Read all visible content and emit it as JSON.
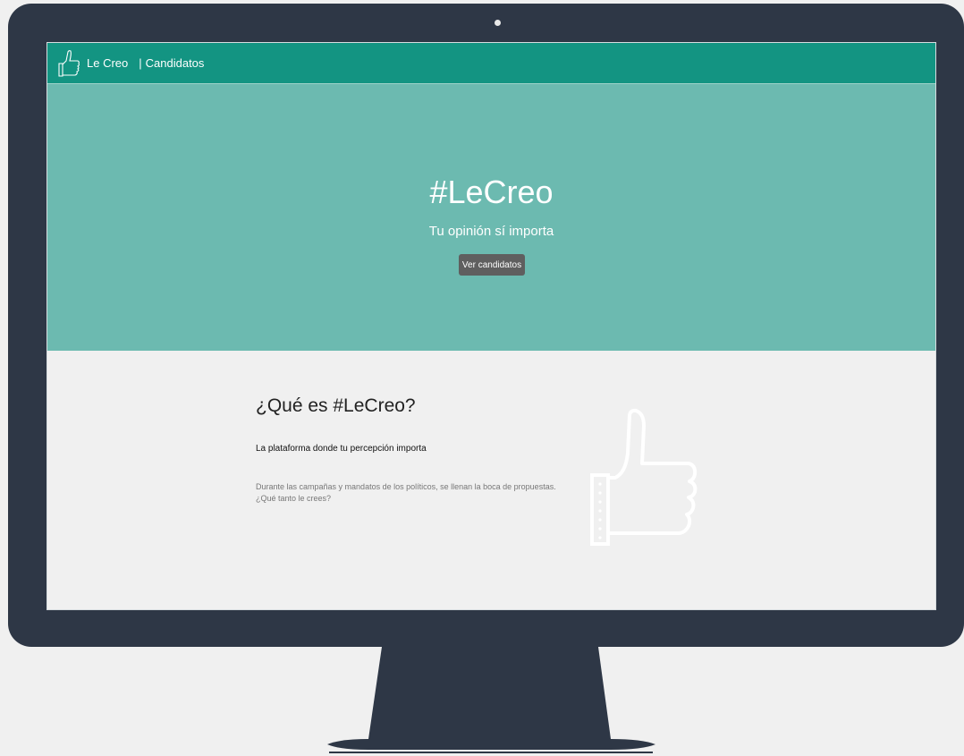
{
  "navbar": {
    "logo_icon": "thumbs-up-icon",
    "brand": "Le Creo",
    "separator": "|",
    "link": "Candidatos"
  },
  "hero": {
    "title": "#LeCreo",
    "subtitle": "Tu opinión sí importa",
    "button_label": "Ver candidatos"
  },
  "about": {
    "title": "¿Qué es #LeCreo?",
    "lead": "La plataforma donde tu percepción importa",
    "body_line1": "Durante las campañas y mandatos de los políticos, se llenan la boca de propuestas.",
    "body_line2": "¿Qué tanto le crees?",
    "illustration_icon": "thumbs-up-icon"
  },
  "colors": {
    "navbar": "#139482",
    "hero": "#6cbab0",
    "button": "#5f5f5f",
    "monitor": "#2e3746",
    "page": "#f0f0f0"
  }
}
